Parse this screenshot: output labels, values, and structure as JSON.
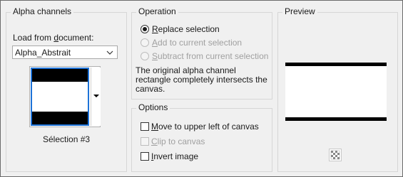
{
  "alpha": {
    "title": "Alpha channels",
    "load_label_pre": "Load from ",
    "load_label_ul": "d",
    "load_label_post": "ocument:",
    "document_value": "Alpha_Abstrait",
    "selection_label": "Sélection #3"
  },
  "operation": {
    "title": "Operation",
    "options": [
      {
        "ul": "R",
        "rest": "eplace selection",
        "checked": true,
        "disabled": false
      },
      {
        "ul": "A",
        "rest": "dd to current selection",
        "checked": false,
        "disabled": true
      },
      {
        "ul": "S",
        "rest": "ubtract from current selection",
        "checked": false,
        "disabled": true
      }
    ],
    "message": "The original alpha channel rectangle completely intersects the canvas."
  },
  "options": {
    "title": "Options",
    "move_ul": "M",
    "move_rest": "ove to upper left of canvas",
    "clip_ul": "C",
    "clip_rest": "lip to canvas",
    "invert_ul": "I",
    "invert_rest": "nvert image"
  },
  "preview": {
    "title": "Preview"
  }
}
